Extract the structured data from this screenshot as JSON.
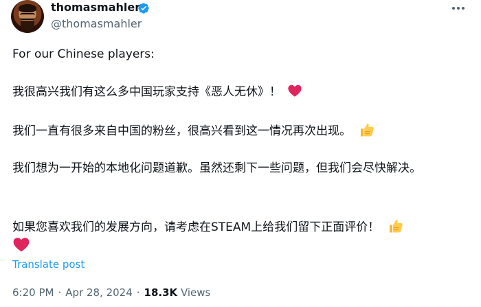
{
  "author": {
    "display_name": "thomasmahler",
    "handle": "@thomasmahler",
    "verified": true,
    "verified_color": "#1d9bf0"
  },
  "tweet": {
    "paragraph_1": "For our Chinese players:",
    "paragraph_2": "我很高兴我们有这么多中国玩家支持《恶人无休》！",
    "paragraph_3": "我们一直有很多来自中国的粉丝，很高兴看到这一情况再次出现。",
    "paragraph_4": "我们想为一开始的本地化问题道歉。虽然还剩下一些问题，但我们会尽快解决。",
    "paragraph_5": "如果您喜欢我们的发展方向，请考虑在STEAM上给我们留下正面评价！",
    "emoji_heart": "red-heart",
    "emoji_thumb": "thumbs-up"
  },
  "translate_label": "Translate post",
  "meta": {
    "time": "6:20 PM",
    "date": "Apr 28, 2024",
    "views_count": "18.3K",
    "views_label": "Views",
    "separator": "·"
  },
  "colors": {
    "text": "#0f1419",
    "secondary": "#536471",
    "link": "#1d9bf0",
    "heart": "#e0245e",
    "thumb": "#f7b633"
  }
}
